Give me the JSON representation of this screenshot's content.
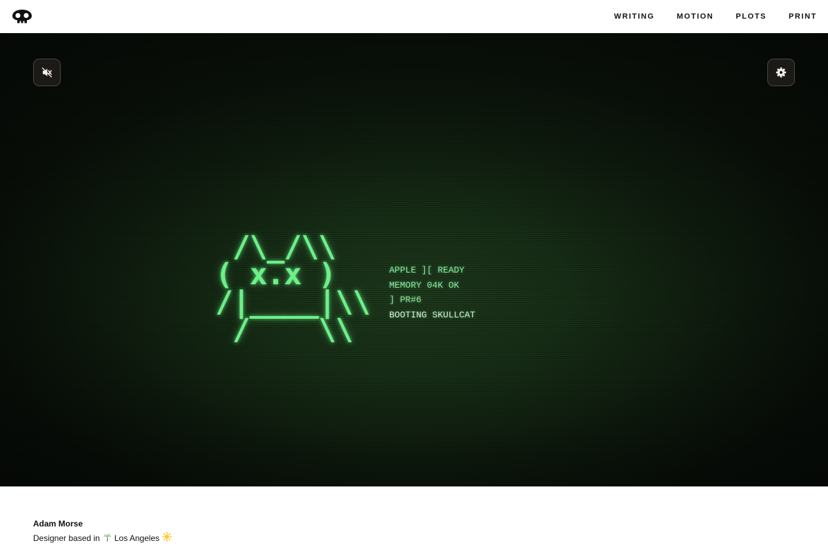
{
  "header": {
    "logo_icon": "skull-cat-logo-icon",
    "nav": [
      {
        "label": "WRITING"
      },
      {
        "label": "MOTION"
      },
      {
        "label": "PLOTS"
      },
      {
        "label": "PRINT"
      }
    ]
  },
  "hero": {
    "mute_icon": "speaker-muted-icon",
    "settings_icon": "gear-icon",
    "ascii_art": [
      " /\\_/\\\\",
      "( x.x )",
      "/|____|\\\\",
      " /    \\\\"
    ],
    "boot_lines": [
      "APPLE ][ READY",
      "MEMORY 04K OK",
      "] PR#6",
      "BOOTING SKULLCAT"
    ],
    "colors": {
      "phosphor": "#6cf08a",
      "background": "#1f3a1d"
    }
  },
  "bio": {
    "name": "Adam Morse",
    "prefix": "Designer based in",
    "palm_icon": "palm-tree-icon",
    "city": "Los Angeles",
    "sun_icon": "sun-icon"
  }
}
